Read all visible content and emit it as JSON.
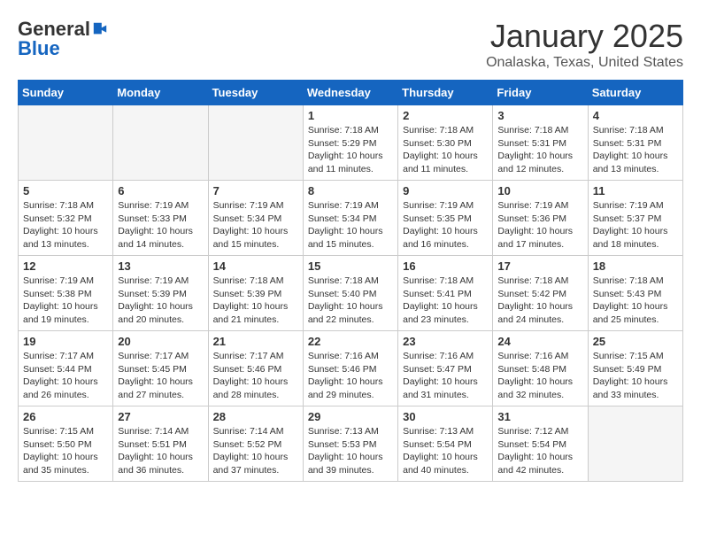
{
  "logo": {
    "general": "General",
    "blue": "Blue"
  },
  "title": "January 2025",
  "subtitle": "Onalaska, Texas, United States",
  "days_of_week": [
    "Sunday",
    "Monday",
    "Tuesday",
    "Wednesday",
    "Thursday",
    "Friday",
    "Saturday"
  ],
  "weeks": [
    [
      {
        "day": "",
        "info": ""
      },
      {
        "day": "",
        "info": ""
      },
      {
        "day": "",
        "info": ""
      },
      {
        "day": "1",
        "info": "Sunrise: 7:18 AM\nSunset: 5:29 PM\nDaylight: 10 hours and 11 minutes."
      },
      {
        "day": "2",
        "info": "Sunrise: 7:18 AM\nSunset: 5:30 PM\nDaylight: 10 hours and 11 minutes."
      },
      {
        "day": "3",
        "info": "Sunrise: 7:18 AM\nSunset: 5:31 PM\nDaylight: 10 hours and 12 minutes."
      },
      {
        "day": "4",
        "info": "Sunrise: 7:18 AM\nSunset: 5:31 PM\nDaylight: 10 hours and 13 minutes."
      }
    ],
    [
      {
        "day": "5",
        "info": "Sunrise: 7:18 AM\nSunset: 5:32 PM\nDaylight: 10 hours and 13 minutes."
      },
      {
        "day": "6",
        "info": "Sunrise: 7:19 AM\nSunset: 5:33 PM\nDaylight: 10 hours and 14 minutes."
      },
      {
        "day": "7",
        "info": "Sunrise: 7:19 AM\nSunset: 5:34 PM\nDaylight: 10 hours and 15 minutes."
      },
      {
        "day": "8",
        "info": "Sunrise: 7:19 AM\nSunset: 5:34 PM\nDaylight: 10 hours and 15 minutes."
      },
      {
        "day": "9",
        "info": "Sunrise: 7:19 AM\nSunset: 5:35 PM\nDaylight: 10 hours and 16 minutes."
      },
      {
        "day": "10",
        "info": "Sunrise: 7:19 AM\nSunset: 5:36 PM\nDaylight: 10 hours and 17 minutes."
      },
      {
        "day": "11",
        "info": "Sunrise: 7:19 AM\nSunset: 5:37 PM\nDaylight: 10 hours and 18 minutes."
      }
    ],
    [
      {
        "day": "12",
        "info": "Sunrise: 7:19 AM\nSunset: 5:38 PM\nDaylight: 10 hours and 19 minutes."
      },
      {
        "day": "13",
        "info": "Sunrise: 7:19 AM\nSunset: 5:39 PM\nDaylight: 10 hours and 20 minutes."
      },
      {
        "day": "14",
        "info": "Sunrise: 7:18 AM\nSunset: 5:39 PM\nDaylight: 10 hours and 21 minutes."
      },
      {
        "day": "15",
        "info": "Sunrise: 7:18 AM\nSunset: 5:40 PM\nDaylight: 10 hours and 22 minutes."
      },
      {
        "day": "16",
        "info": "Sunrise: 7:18 AM\nSunset: 5:41 PM\nDaylight: 10 hours and 23 minutes."
      },
      {
        "day": "17",
        "info": "Sunrise: 7:18 AM\nSunset: 5:42 PM\nDaylight: 10 hours and 24 minutes."
      },
      {
        "day": "18",
        "info": "Sunrise: 7:18 AM\nSunset: 5:43 PM\nDaylight: 10 hours and 25 minutes."
      }
    ],
    [
      {
        "day": "19",
        "info": "Sunrise: 7:17 AM\nSunset: 5:44 PM\nDaylight: 10 hours and 26 minutes."
      },
      {
        "day": "20",
        "info": "Sunrise: 7:17 AM\nSunset: 5:45 PM\nDaylight: 10 hours and 27 minutes."
      },
      {
        "day": "21",
        "info": "Sunrise: 7:17 AM\nSunset: 5:46 PM\nDaylight: 10 hours and 28 minutes."
      },
      {
        "day": "22",
        "info": "Sunrise: 7:16 AM\nSunset: 5:46 PM\nDaylight: 10 hours and 29 minutes."
      },
      {
        "day": "23",
        "info": "Sunrise: 7:16 AM\nSunset: 5:47 PM\nDaylight: 10 hours and 31 minutes."
      },
      {
        "day": "24",
        "info": "Sunrise: 7:16 AM\nSunset: 5:48 PM\nDaylight: 10 hours and 32 minutes."
      },
      {
        "day": "25",
        "info": "Sunrise: 7:15 AM\nSunset: 5:49 PM\nDaylight: 10 hours and 33 minutes."
      }
    ],
    [
      {
        "day": "26",
        "info": "Sunrise: 7:15 AM\nSunset: 5:50 PM\nDaylight: 10 hours and 35 minutes."
      },
      {
        "day": "27",
        "info": "Sunrise: 7:14 AM\nSunset: 5:51 PM\nDaylight: 10 hours and 36 minutes."
      },
      {
        "day": "28",
        "info": "Sunrise: 7:14 AM\nSunset: 5:52 PM\nDaylight: 10 hours and 37 minutes."
      },
      {
        "day": "29",
        "info": "Sunrise: 7:13 AM\nSunset: 5:53 PM\nDaylight: 10 hours and 39 minutes."
      },
      {
        "day": "30",
        "info": "Sunrise: 7:13 AM\nSunset: 5:54 PM\nDaylight: 10 hours and 40 minutes."
      },
      {
        "day": "31",
        "info": "Sunrise: 7:12 AM\nSunset: 5:54 PM\nDaylight: 10 hours and 42 minutes."
      },
      {
        "day": "",
        "info": ""
      }
    ]
  ]
}
